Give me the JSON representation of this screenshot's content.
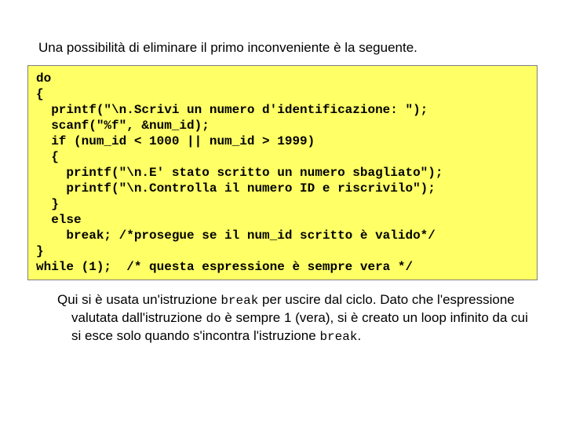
{
  "intro": "Una possibilità di eliminare il primo inconveniente è la seguente.",
  "code": {
    "l01": "do",
    "l02": "{",
    "l03": "  printf(\"\\n.Scrivi un numero d'identificazione: \");",
    "l04": "  scanf(\"%f\", &num_id);",
    "l05": "  if (num_id < 1000 || num_id > 1999)",
    "l06": "  {",
    "l07": "    printf(\"\\n.E' stato scritto un numero sbagliato\");",
    "l08": "    printf(\"\\n.Controlla il numero ID e riscrivilo\");",
    "l09": "  }",
    "l10": "  else",
    "l11": "    break; /*prosegue se il num_id scritto è valido*/",
    "l12": "}",
    "l13": "while (1);  /* questa espressione è sempre vera */"
  },
  "outro": {
    "t1": "Qui si è usata un'istruzione ",
    "c1": "break",
    "t2": " per uscire dal ciclo. Dato che l'espressione valutata dall'istruzione ",
    "c2": "do",
    "t3": " è sempre 1 (vera), si è creato un loop infinito da cui si esce solo quando s'incontra l'istruzione ",
    "c3": "break",
    "t4": "."
  }
}
